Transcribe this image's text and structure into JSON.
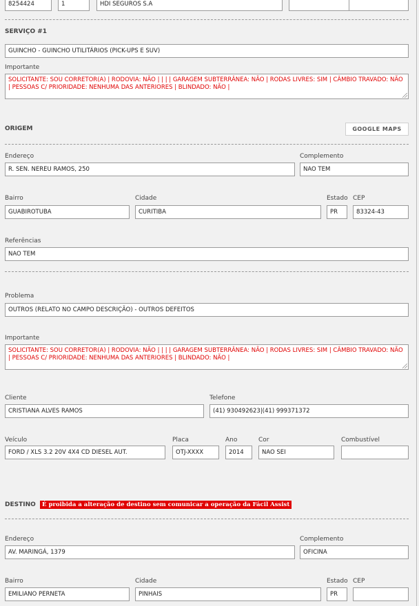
{
  "top_row": {
    "field1": "8254424",
    "field2": "1",
    "field3": "HDI SEGUROS S.A",
    "field4": "",
    "field5": ""
  },
  "servico": {
    "title": "SERVIÇO #1",
    "service_value": "GUINCHO - GUINCHO UTILITÁRIOS (PICK-UPS E SUV)",
    "importante_label": "Importante",
    "importante_text": "SOLICITANTE: SOU CORRETOR(A) | RODOVIA: NÃO | | | | GARAGEM SUBTERRÂNEA: NÃO | RODAS LIVRES: SIM | CÂMBIO TRAVADO: NÃO | PESSOAS C/ PRIORIDADE: NENHUMA DAS ANTERIORES | BLINDADO: NÃO |"
  },
  "origem": {
    "title": "ORIGEM",
    "google_maps_label": "GOOGLE MAPS",
    "endereco_label": "Endereço",
    "endereco_value": "R. SEN. NEREU RAMOS, 250",
    "complemento_label": "Complemento",
    "complemento_value": "NAO TEM",
    "bairro_label": "Bairro",
    "bairro_value": "GUABIROTUBA",
    "cidade_label": "Cidade",
    "cidade_value": "CURITIBA",
    "estado_label": "Estado",
    "estado_value": "PR",
    "cep_label": "CEP",
    "cep_value": "83324-43",
    "referencias_label": "Referências",
    "referencias_value": "NAO TEM"
  },
  "problema": {
    "problema_label": "Problema",
    "problema_value": "OUTROS (RELATO NO CAMPO DESCRIÇÃO) - OUTROS DEFEITOS",
    "importante_label": "Importante",
    "importante_text": "SOLICITANTE: SOU CORRETOR(A) | RODOVIA: NÃO | | | | GARAGEM SUBTERRÂNEA: NÃO | RODAS LIVRES: SIM | CÂMBIO TRAVADO: NÃO | PESSOAS C/ PRIORIDADE: NENHUMA DAS ANTERIORES | BLINDADO: NÃO |"
  },
  "cliente": {
    "cliente_label": "Cliente",
    "cliente_value": "CRISTIANA ALVES RAMOS",
    "telefone_label": "Telefone",
    "telefone_value": "(41) 930492623|(41) 999371372"
  },
  "veiculo": {
    "veiculo_label": "Veículo",
    "veiculo_value": "FORD / XLS 3.2 20V 4X4 CD DIESEL AUT.",
    "placa_label": "Placa",
    "placa_value": "OTJ-XXXX",
    "ano_label": "Ano",
    "ano_value": "2014",
    "cor_label": "Cor",
    "cor_value": "NAO SEI",
    "combustivel_label": "Combustível",
    "combustivel_value": ""
  },
  "destino": {
    "title": "DESTINO",
    "warning": "É proibida a alteração de destino sem comunicar a operação da Fácil Assist",
    "endereco_label": "Endereço",
    "endereco_value": "AV. MARINGÁ, 1379",
    "complemento_label": "Complemento",
    "complemento_value": "OFICINA",
    "bairro_label": "Bairro",
    "bairro_value": "EMILIANO PERNETA",
    "cidade_label": "Cidade",
    "cidade_value": "PINHAIS",
    "estado_label": "Estado",
    "estado_value": "PR",
    "cep_label": "CEP",
    "cep_value": ""
  },
  "colors": {
    "background": "#f1f1f1",
    "warning_bg": "#e00000",
    "important_text": "#e00000"
  }
}
